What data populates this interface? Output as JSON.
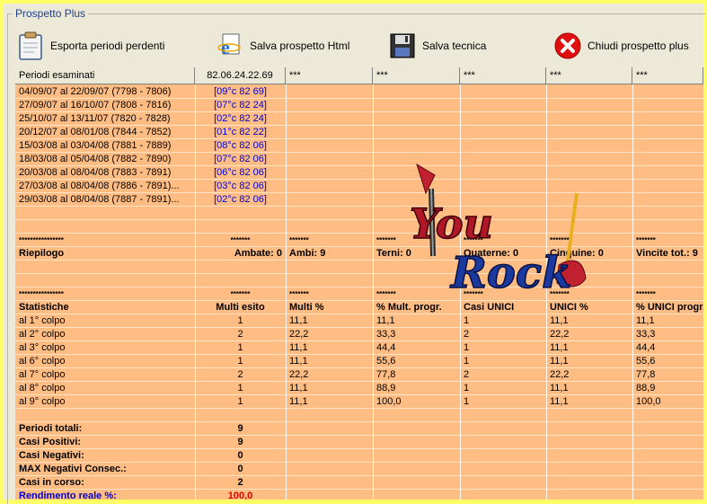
{
  "window": {
    "group_title": "Prospetto Plus"
  },
  "toolbar": {
    "export_label": "Esporta periodi perdenti",
    "save_html_label": "Salva prospetto Html",
    "save_tech_label": "Salva tecnica",
    "close_label": "Chiudi prospetto plus"
  },
  "columns": [
    "Periodi esaminati",
    "82.06.24.22.69",
    "***",
    "***",
    "***",
    "***",
    "***"
  ],
  "periods": [
    {
      "range": "04/09/07 al 22/09/07  (7798 - 7806)",
      "result": "[09°c 82 69]"
    },
    {
      "range": "27/09/07 al 16/10/07  (7808 - 7816)",
      "result": "[07°c 82 24]"
    },
    {
      "range": "25/10/07 al 13/11/07  (7820 - 7828)",
      "result": "[02°c 82 24]"
    },
    {
      "range": "20/12/07 al 08/01/08  (7844 - 7852)",
      "result": "[01°c 82 22]"
    },
    {
      "range": "15/03/08 al 03/04/08  (7881 - 7889)",
      "result": "[08°c 82 06]"
    },
    {
      "range": "18/03/08 al 05/04/08  (7882 - 7890)",
      "result": "[07°c 82 06]"
    },
    {
      "range": "20/03/08 al 08/04/08  (7883 - 7891)",
      "result": "[06°c 82 06]"
    },
    {
      "range": "27/03/08 al 08/04/08  (7886 - 7891)...",
      "result": "[03°c 82 06]"
    },
    {
      "range": "29/03/08 al 08/04/08  (7887 - 7891)...",
      "result": "[02°c 82 06]"
    }
  ],
  "riepilogo": {
    "stars_long": "****************",
    "stars_short": "*******",
    "label": "Riepilogo",
    "cells": [
      "Ambate: 0",
      "Ambi: 9",
      "Terni: 0",
      "Quaterne: 0",
      "Cinquine: 0",
      "Vincite tot.: 9"
    ]
  },
  "statistiche": {
    "stars_long": "****************",
    "stars_short": "*******",
    "headers": [
      "Statistiche",
      "Multi esito",
      "Multi %",
      "% Mult. progr.",
      "Casi UNICI",
      "UNICI %",
      "% UNICI progr."
    ],
    "rows": [
      [
        "al 1° colpo",
        "1",
        "11,1",
        "11,1",
        "1",
        "11,1",
        "11,1"
      ],
      [
        "al 2° colpo",
        "2",
        "22,2",
        "33,3",
        "2",
        "22,2",
        "33,3"
      ],
      [
        "al 3° colpo",
        "1",
        "11,1",
        "44,4",
        "1",
        "11,1",
        "44,4"
      ],
      [
        "al 6° colpo",
        "1",
        "11,1",
        "55,6",
        "1",
        "11,1",
        "55,6"
      ],
      [
        "al 7° colpo",
        "2",
        "22,2",
        "77,8",
        "2",
        "22,2",
        "77,8"
      ],
      [
        "al 8° colpo",
        "1",
        "11,1",
        "88,9",
        "1",
        "11,1",
        "88,9"
      ],
      [
        "al 9° colpo",
        "1",
        "11,1",
        "100,0",
        "1",
        "11,1",
        "100,0"
      ]
    ]
  },
  "totali": [
    {
      "label": "Periodi totali:",
      "value": "9"
    },
    {
      "label": "Casi Positivi:",
      "value": "9"
    },
    {
      "label": "Casi Negativi:",
      "value": "0"
    },
    {
      "label": "MAX Negativi Consec.:",
      "value": "0"
    },
    {
      "label": "Casi in corso:",
      "value": "2"
    },
    {
      "label": "Rendimento reale %:",
      "value": "100,0"
    }
  ],
  "logo": {
    "text_top": "You",
    "text_bottom": "Rock"
  },
  "colors": {
    "grid_bg": "#ffbd84",
    "result_blue": "#0000cc",
    "rendimento_label": "#0000cc",
    "rendimento_value": "#e00000"
  }
}
